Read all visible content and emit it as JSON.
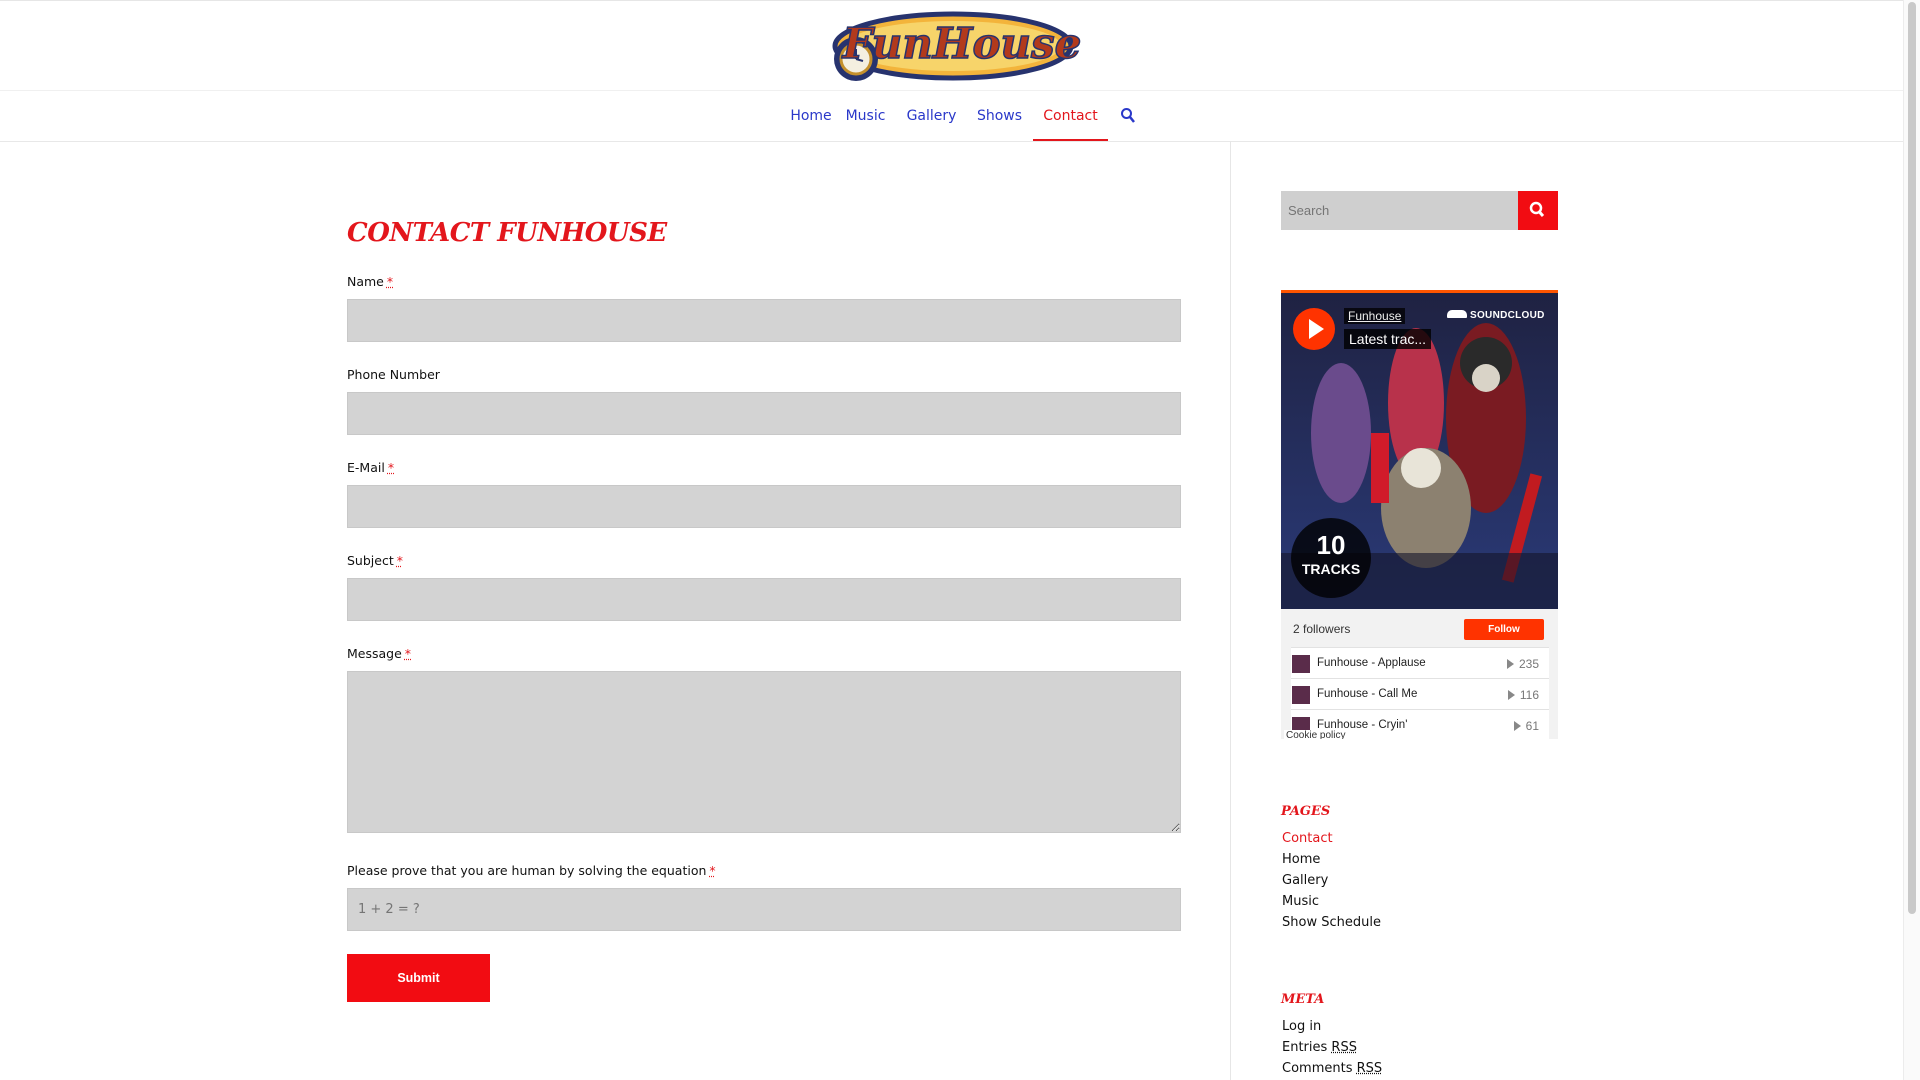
{
  "header": {
    "logo_text": "FunHouse",
    "nav": [
      {
        "label": "Home"
      },
      {
        "label": "Music"
      },
      {
        "label": "Gallery"
      },
      {
        "label": "Shows"
      },
      {
        "label": "Contact",
        "active": true
      }
    ]
  },
  "form": {
    "title": "CONTACT FUNHOUSE",
    "required_mark": "*",
    "fields": [
      {
        "label": "Name",
        "required": true,
        "value": ""
      },
      {
        "label": "Phone Number",
        "required": false,
        "value": ""
      },
      {
        "label": "E-Mail",
        "required": true,
        "value": ""
      },
      {
        "label": "Subject",
        "required": true,
        "value": ""
      },
      {
        "label": "Message",
        "required": true,
        "value": ""
      }
    ],
    "captcha_label": "Please prove that you are human by solving the equation",
    "captcha_placeholder": "1 + 2 = ?",
    "submit_label": "Submit"
  },
  "sidebar": {
    "search_placeholder": "Search",
    "soundcloud": {
      "artist": "Funhouse",
      "track_title": "Latest trac...",
      "brand": "SOUNDCLOUD",
      "track_count": "10",
      "track_count_label": "TRACKS",
      "followers": "2 followers",
      "follow_label": "Follow",
      "tracks": [
        {
          "title": "Funhouse - Applause",
          "plays": "235"
        },
        {
          "title": "Funhouse - Call Me",
          "plays": "116"
        },
        {
          "title": "Funhouse - Cryin'",
          "plays": "61"
        }
      ],
      "cookie": "Cookie policy"
    },
    "pages_heading": "PAGES",
    "pages": [
      {
        "label": "Contact",
        "active": true
      },
      {
        "label": "Home"
      },
      {
        "label": "Gallery"
      },
      {
        "label": "Music"
      },
      {
        "label": "Show Schedule"
      }
    ],
    "meta_heading": "META",
    "meta": {
      "login": "Log in",
      "entries": "Entries",
      "comments": "Comments",
      "rss": "RSS"
    }
  },
  "colors": {
    "accent_red": "#e3161c",
    "nav_blue": "#2a38c9",
    "soundcloud_orange": "#ff5500",
    "field_gray": "#d3d3d3"
  }
}
